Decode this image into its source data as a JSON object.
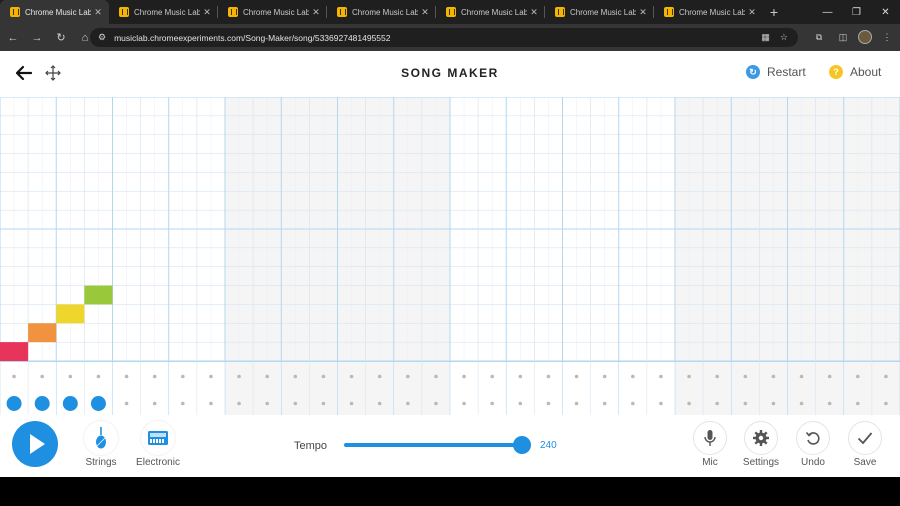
{
  "browser": {
    "tabs": [
      {
        "title": "Chrome Music Lab - S",
        "active": true
      },
      {
        "title": "Chrome Music Lab - S",
        "active": false
      },
      {
        "title": "Chrome Music Lab - S",
        "active": false
      },
      {
        "title": "Chrome Music Lab - S",
        "active": false
      },
      {
        "title": "Chrome Music Lab - S",
        "active": false
      },
      {
        "title": "Chrome Music Lab - S",
        "active": false
      },
      {
        "title": "Chrome Music Lab - S",
        "active": false
      }
    ],
    "url": "musiclab.chromeexperiments.com/Song-Maker/song/5336927481495552"
  },
  "header": {
    "title": "SONG MAKER",
    "restart_label": "Restart",
    "about_label": "About"
  },
  "grid": {
    "columns": 32,
    "rows": 14,
    "notes": [
      {
        "col": 0,
        "row": 13,
        "color": "#e8335a"
      },
      {
        "col": 1,
        "row": 12,
        "color": "#f09240"
      },
      {
        "col": 2,
        "row": 11,
        "color": "#eed62c"
      },
      {
        "col": 3,
        "row": 10,
        "color": "#99c93b"
      }
    ],
    "colors": {
      "line": "#d5e5f3",
      "strong_line": "#b3d7f0",
      "shade": "#f5f5f5"
    }
  },
  "percussion": {
    "active_hits": [
      {
        "col": 0,
        "row": 1
      },
      {
        "col": 1,
        "row": 1
      },
      {
        "col": 2,
        "row": 1
      },
      {
        "col": 3,
        "row": 1
      }
    ],
    "accent": "#1e8fe1"
  },
  "controls": {
    "instrument_1": "Strings",
    "instrument_2": "Electronic",
    "tempo_label": "Tempo",
    "tempo_value": "240",
    "mic_label": "Mic",
    "settings_label": "Settings",
    "undo_label": "Undo",
    "save_label": "Save"
  }
}
